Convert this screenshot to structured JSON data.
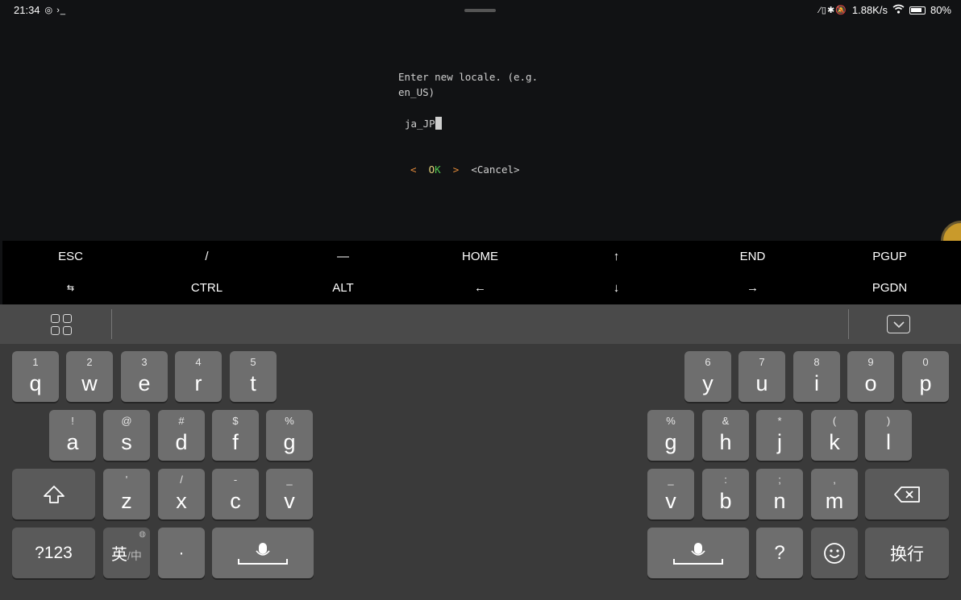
{
  "status_bar": {
    "time": "21:34",
    "left_icons": "◎ ›_",
    "network_speed": "1.88K/s",
    "battery": "80%"
  },
  "terminal": {
    "prompt_line1": "Enter new locale. (e.g.",
    "prompt_line2": "en_US)",
    "input_value": "ja_JP",
    "ok_left": "<",
    "ok_o": "O",
    "ok_k": "K",
    "ok_right": ">",
    "cancel": "<Cancel>"
  },
  "extra_keys": {
    "row1": [
      "ESC",
      "/",
      "—",
      "HOME",
      "↑",
      "END",
      "PGUP"
    ],
    "row2": [
      "⇆",
      "CTRL",
      "ALT",
      "←",
      "↓",
      "→",
      "PGDN"
    ]
  },
  "keyboard": {
    "row1_left": [
      {
        "hint": "1",
        "key": "q"
      },
      {
        "hint": "2",
        "key": "w"
      },
      {
        "hint": "3",
        "key": "e"
      },
      {
        "hint": "4",
        "key": "r"
      },
      {
        "hint": "5",
        "key": "t"
      }
    ],
    "row1_right": [
      {
        "hint": "6",
        "key": "y"
      },
      {
        "hint": "7",
        "key": "u"
      },
      {
        "hint": "8",
        "key": "i"
      },
      {
        "hint": "9",
        "key": "o"
      },
      {
        "hint": "0",
        "key": "p"
      }
    ],
    "row2_left": [
      {
        "hint": "!",
        "key": "a"
      },
      {
        "hint": "@",
        "key": "s"
      },
      {
        "hint": "#",
        "key": "d"
      },
      {
        "hint": "$",
        "key": "f"
      },
      {
        "hint": "%",
        "key": "g"
      }
    ],
    "row2_right": [
      {
        "hint": "%",
        "key": "g"
      },
      {
        "hint": "&",
        "key": "h"
      },
      {
        "hint": "*",
        "key": "j"
      },
      {
        "hint": "(",
        "key": "k"
      },
      {
        "hint": ")",
        "key": "l"
      }
    ],
    "row3_left": [
      {
        "hint": "'",
        "key": "z"
      },
      {
        "hint": "/",
        "key": "x"
      },
      {
        "hint": "-",
        "key": "c"
      },
      {
        "hint": "_",
        "key": "v"
      }
    ],
    "row3_right": [
      {
        "hint": "_",
        "key": "v"
      },
      {
        "hint": ":",
        "key": "b"
      },
      {
        "hint": ";",
        "key": "n"
      },
      {
        "hint": ",",
        "key": "m"
      }
    ],
    "symbols_label": "?123",
    "lang_label": "英",
    "lang_sub": "/中",
    "dot_label": "·",
    "question_label": "?",
    "enter_label": "换行"
  }
}
